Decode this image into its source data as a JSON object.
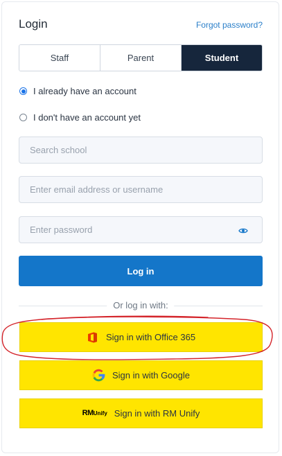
{
  "header": {
    "title": "Login",
    "forgot_label": "Forgot password?"
  },
  "tabs": [
    {
      "label": "Staff",
      "active": false
    },
    {
      "label": "Parent",
      "active": false
    },
    {
      "label": "Student",
      "active": true
    }
  ],
  "account_options": [
    {
      "label": "I already have an account",
      "checked": true
    },
    {
      "label": "I don't have an account yet",
      "checked": false
    }
  ],
  "fields": {
    "school": {
      "placeholder": "Search school",
      "value": ""
    },
    "email": {
      "placeholder": "Enter email address or username",
      "value": ""
    },
    "password": {
      "placeholder": "Enter password",
      "value": ""
    }
  },
  "login_button": "Log in",
  "divider_label": "Or log in with:",
  "sso_buttons": [
    {
      "label": "Sign in with Office 365",
      "icon": "office-365-icon"
    },
    {
      "label": "Sign in with Google",
      "icon": "google-icon"
    },
    {
      "label": "Sign in with RM Unify",
      "icon": "rm-unify-icon"
    }
  ],
  "rm_logo": {
    "top": "RM",
    "bottom": "Unify"
  },
  "colors": {
    "primary": "#1476c9",
    "active_tab": "#16263c",
    "sso_background": "#ffe500",
    "annotation": "#d4242a",
    "link": "#2a7fc9"
  }
}
